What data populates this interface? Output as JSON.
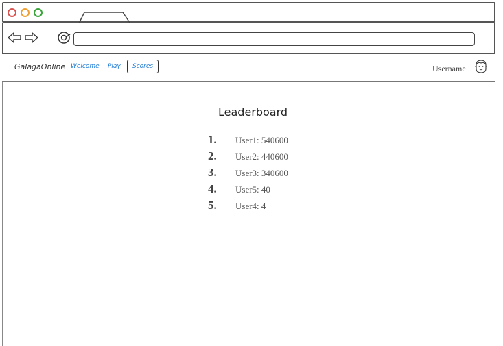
{
  "window": {
    "tab_title": "",
    "url": ""
  },
  "appnav": {
    "brand": "GalagaOnline",
    "links": [
      {
        "label": "Welcome"
      },
      {
        "label": "Play"
      },
      {
        "label": "Scores",
        "active": true
      }
    ],
    "username": "Username"
  },
  "leaderboard": {
    "title": "Leaderboard",
    "entries": [
      {
        "rank": "1.",
        "text": "User1: 540600"
      },
      {
        "rank": "2.",
        "text": "User2: 440600"
      },
      {
        "rank": "3.",
        "text": "User3: 340600"
      },
      {
        "rank": "4.",
        "text": "User5: 40"
      },
      {
        "rank": "5.",
        "text": "User4: 4"
      }
    ]
  },
  "colors": {
    "link": "#1e7bd6",
    "close_dot": "#d9534f",
    "minimize_dot": "#f0a030",
    "maximize_dot": "#3aa63a"
  }
}
